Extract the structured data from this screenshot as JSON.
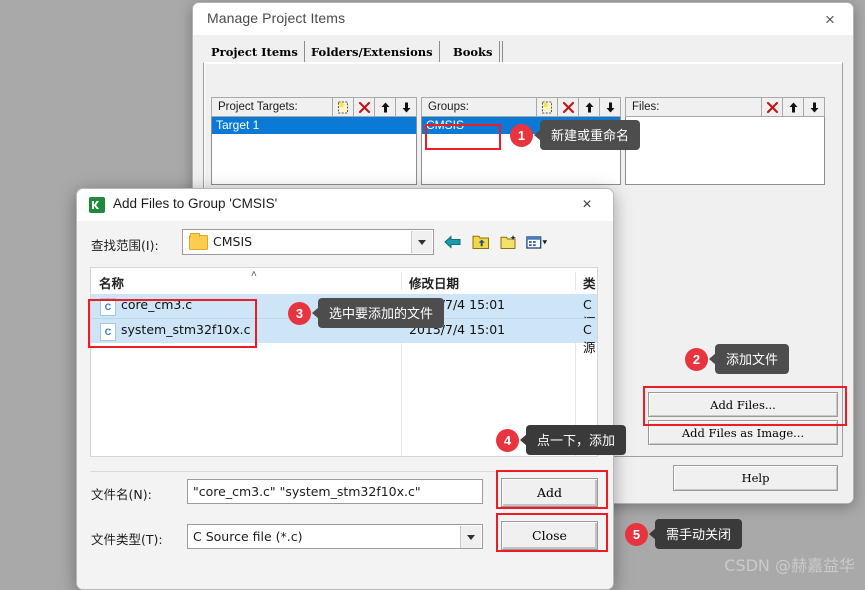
{
  "manage_window": {
    "title": "Manage Project Items",
    "close_icon": "×",
    "tabs": [
      {
        "label": "Project Items",
        "selected": true
      },
      {
        "label": "Folders/Extensions",
        "selected": false
      },
      {
        "label": "Books",
        "selected": false
      }
    ],
    "columns": {
      "targets": {
        "label": "Project Targets:",
        "items": [
          "Target 1"
        ],
        "toolbar": [
          "new-icon",
          "delete-icon",
          "move-up-icon",
          "move-down-icon"
        ]
      },
      "groups": {
        "label": "Groups:",
        "items": [
          "CMSIS"
        ],
        "toolbar": [
          "new-icon",
          "delete-icon",
          "move-up-icon",
          "move-down-icon"
        ]
      },
      "files": {
        "label": "Files:",
        "items": [],
        "toolbar": [
          "delete-icon",
          "move-up-icon",
          "move-down-icon"
        ]
      }
    },
    "buttons": {
      "add_files": "Add Files...",
      "add_files_as_image": "Add Files as Image...",
      "help": "Help"
    }
  },
  "add_files_dialog": {
    "title": "Add Files to Group 'CMSIS'",
    "app_icon": "keil-icon",
    "close_icon": "×",
    "look_in": {
      "label": "查找范围(I):",
      "value": "CMSIS",
      "icon": "folder-icon"
    },
    "toolbar": [
      "back-icon",
      "up-folder-icon",
      "new-folder-icon",
      "view-mode-icon"
    ],
    "file_list": {
      "headers": [
        "名称",
        "修改日期",
        "类"
      ],
      "sort_indicator": "˄",
      "rows": [
        {
          "icon": "c-file-icon",
          "name": "core_cm3.c",
          "date": "2015/7/4 15:01",
          "type": "C 源",
          "selected": true
        },
        {
          "icon": "c-file-icon",
          "name": "system_stm32f10x.c",
          "date": "2015/7/4 15:01",
          "type": "C 源",
          "selected": true
        }
      ]
    },
    "file_name": {
      "label": "文件名(N):",
      "value": "\"core_cm3.c\" \"system_stm32f10x.c\""
    },
    "file_type": {
      "label": "文件类型(T):",
      "value": "C Source file (*.c)"
    },
    "buttons": {
      "add": "Add",
      "close": "Close"
    }
  },
  "annotations": [
    {
      "number": "1",
      "text": "新建或重命名"
    },
    {
      "number": "2",
      "text": "添加文件"
    },
    {
      "number": "3",
      "text": "选中要添加的文件"
    },
    {
      "number": "4",
      "text": "点一下，添加"
    },
    {
      "number": "5",
      "text": "需手动关闭"
    }
  ],
  "watermark": "CSDN @赫嘉益华",
  "colors": {
    "highlight": "#ee1c25",
    "badge": "#e8343f",
    "bubble": "#4d4d4d",
    "selection": "#0a7ad6",
    "row_selection": "#cde5f7",
    "desktop": "#a9a9a9"
  }
}
